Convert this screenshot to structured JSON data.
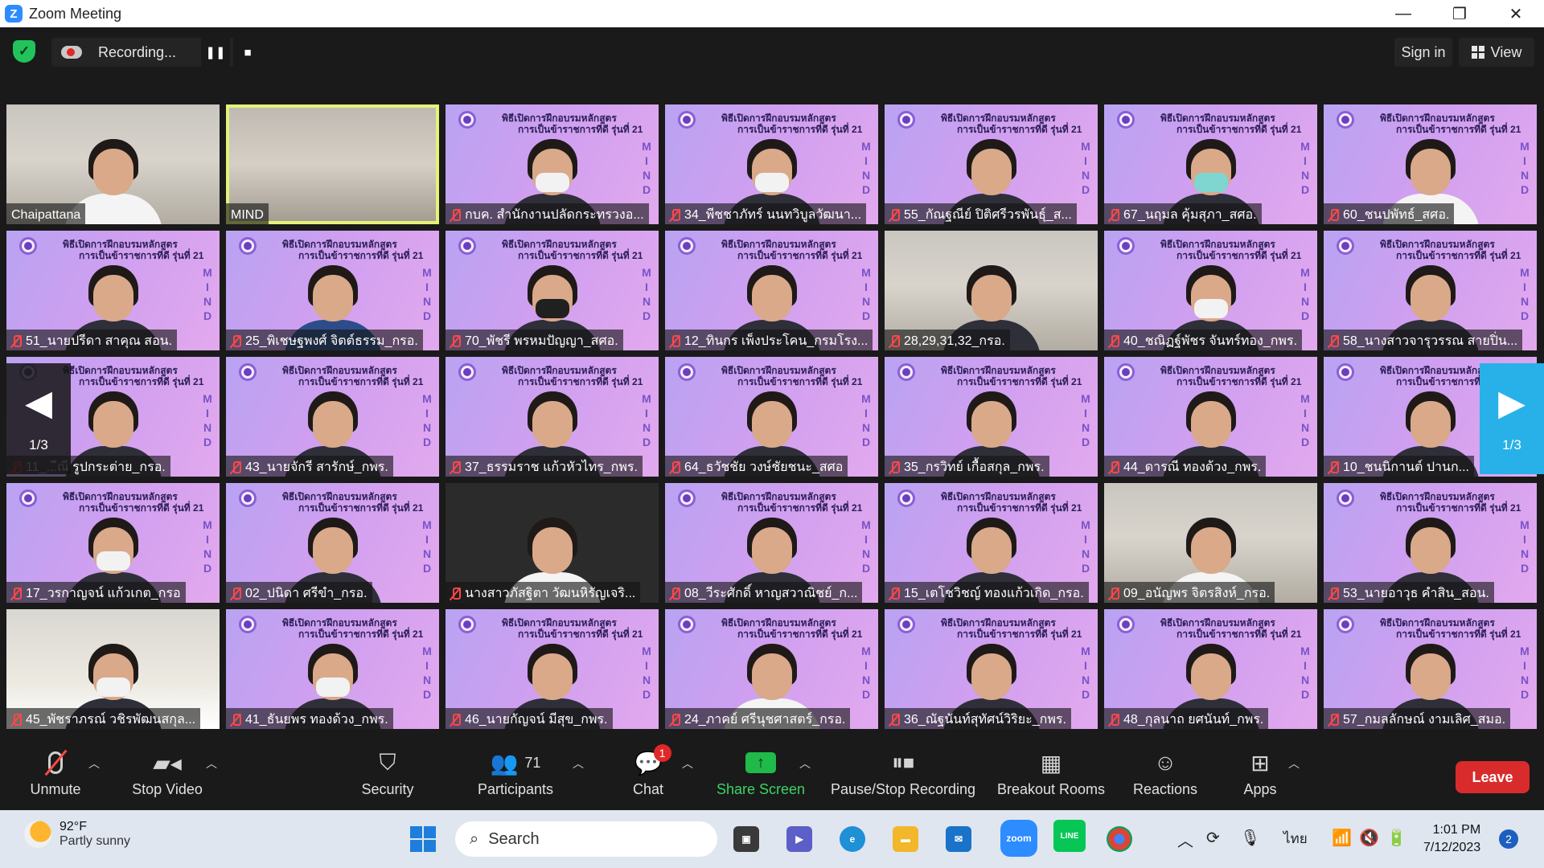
{
  "window": {
    "title": "Zoom Meeting",
    "buttons": [
      "—",
      "❐",
      "✕"
    ]
  },
  "topbar": {
    "recording_label": "Recording...",
    "pause_glyph": "❚❚",
    "stop_glyph": "■",
    "signin_label": "Sign in",
    "view_label": "View"
  },
  "banner": {
    "line1": "พิธีเปิดการฝึกอบรมหลักสูตร",
    "line2": "การเป็นข้าราชการที่ดี รุ่นที่ 21",
    "vertical_letters": [
      "M",
      "I",
      "N",
      "D"
    ]
  },
  "tiles": [
    {
      "name": "Chaipattana",
      "muted": false,
      "style": "office",
      "person": "w"
    },
    {
      "name": "MIND",
      "muted": false,
      "style": "room",
      "person": "none",
      "active": true
    },
    {
      "name": "กบค. สำนักงานปลัดกระทรวงอ...",
      "muted": true,
      "style": "mind",
      "person": "m"
    },
    {
      "name": "34_พีชชาภัทร์ นนทวิบูลวัฒนา...",
      "muted": true,
      "style": "mind",
      "person": "m"
    },
    {
      "name": "55_กัณฐณีย์ ปิติศรีวรพันธุ์_ส...",
      "muted": true,
      "style": "mind",
      "person": ""
    },
    {
      "name": "67_นฤมล คุ้มสุภา_สศอ.",
      "muted": true,
      "style": "mind",
      "person": "mg"
    },
    {
      "name": "60_ชนปพัทธ์_สศอ.",
      "muted": true,
      "style": "mind",
      "person": "w"
    },
    {
      "name": "51_นายปรีดา สาคุณ สอน.",
      "muted": true,
      "style": "mind",
      "person": ""
    },
    {
      "name": "25_พิเชษฐพงศ์ จิตต์ธรรม_กรอ.",
      "muted": true,
      "style": "mind",
      "person": "b"
    },
    {
      "name": "70_พัชรี พรหมปัญญา_สศอ.",
      "muted": true,
      "style": "mind",
      "person": "mk"
    },
    {
      "name": "12_ทินกร เพ็งประโคน_กรมโรง...",
      "muted": true,
      "style": "mind",
      "person": ""
    },
    {
      "name": "28,29,31,32_กรอ.",
      "muted": true,
      "style": "office",
      "person": ""
    },
    {
      "name": "40_ชณิฏฐ์พัชร จันทร์ทอง_กพร.",
      "muted": true,
      "style": "mind",
      "person": "m"
    },
    {
      "name": "58_นางสาวจารุวรรณ สายปิ่น...",
      "muted": true,
      "style": "mind",
      "person": ""
    },
    {
      "name": "11_...ีณี รูปกระต่าย_กรอ.",
      "muted": true,
      "style": "mind",
      "person": ""
    },
    {
      "name": "43_นายจักรี สารักษ์_กพร.",
      "muted": true,
      "style": "mind",
      "person": ""
    },
    {
      "name": "37_ธรรมราช แก้วหัวไทร_กพร.",
      "muted": true,
      "style": "mind",
      "person": ""
    },
    {
      "name": "64_ธวัชชัย วงษ์ชัยชนะ_สศอ",
      "muted": true,
      "style": "mind",
      "person": ""
    },
    {
      "name": "35_กรวิทย์ เกื้อสกุล_กพร.",
      "muted": true,
      "style": "mind",
      "person": ""
    },
    {
      "name": "44_ดารณี ทองด้วง_กพร.",
      "muted": true,
      "style": "mind",
      "person": ""
    },
    {
      "name": "10_ชนนิกานต์ ปานก...",
      "muted": true,
      "style": "mind",
      "person": ""
    },
    {
      "name": "17_วรกาญจน์ แก้วเกต_กรอ",
      "muted": true,
      "style": "mind",
      "person": "m"
    },
    {
      "name": "02_ปนิดา ศรีขำ_กรอ.",
      "muted": true,
      "style": "mind",
      "person": ""
    },
    {
      "name": "นางสาวภัสฐิตา วัฒนหิรัญเจริ...",
      "muted": true,
      "style": "dark",
      "person": "w"
    },
    {
      "name": "08_วีระศักดิ์ หาญสวาณิชย์_ก...",
      "muted": true,
      "style": "mind",
      "person": ""
    },
    {
      "name": "15_เตโชวิชญ์ ทองแก้วเกิด_กรอ.",
      "muted": true,
      "style": "mind",
      "person": ""
    },
    {
      "name": "09_อนัญพร จิตรสิงห์_กรอ.",
      "muted": true,
      "style": "office",
      "person": "w"
    },
    {
      "name": "53_นายอาวุธ คำสิน_สอน.",
      "muted": true,
      "style": "mind",
      "person": ""
    },
    {
      "name": "45_พัชราภรณ์ วชิรพัฒนสกุล...",
      "muted": true,
      "style": "hotel",
      "person": "m"
    },
    {
      "name": "41_ธันยพร ทองด้วง_กพร.",
      "muted": true,
      "style": "mind",
      "person": "m"
    },
    {
      "name": "46_นายกัญจน์ มีสุข_กพร.",
      "muted": true,
      "style": "mind",
      "person": ""
    },
    {
      "name": "24_ภาคย์ ศรีนุชศาสตร์_กรอ.",
      "muted": true,
      "style": "mind",
      "person": "w"
    },
    {
      "name": "36_ณัฐนันท์สุทัศน์วิริยะ_กพร.",
      "muted": true,
      "style": "mind",
      "person": ""
    },
    {
      "name": "48_กุลนาถ ยศนันท์_กพร.",
      "muted": true,
      "style": "mind",
      "person": ""
    },
    {
      "name": "57_กมลลักษณ์ งามเลิศ_สมอ.",
      "muted": true,
      "style": "mind",
      "person": ""
    }
  ],
  "pagination": {
    "left": "1/3",
    "right": "1/3"
  },
  "toolbar": {
    "unmute": "Unmute",
    "stop_video": "Stop Video",
    "security": "Security",
    "participants": "Participants",
    "participants_count": "71",
    "chat": "Chat",
    "chat_badge": "1",
    "share_screen": "Share Screen",
    "pause_stop_recording": "Pause/Stop Recording",
    "breakout_rooms": "Breakout Rooms",
    "reactions": "Reactions",
    "apps": "Apps",
    "leave": "Leave",
    "colors": {
      "share": "#1fba4a",
      "leave": "#d92b2b",
      "active_speaker": "#e4f27a"
    }
  },
  "taskbar": {
    "temperature": "92°F",
    "condition": "Partly sunny",
    "search": "Search",
    "lang": "ไทย",
    "time": "1:01 PM",
    "date": "7/12/2023",
    "notifications": "2",
    "zoom_label": "zoom",
    "line_label": "LINE"
  }
}
